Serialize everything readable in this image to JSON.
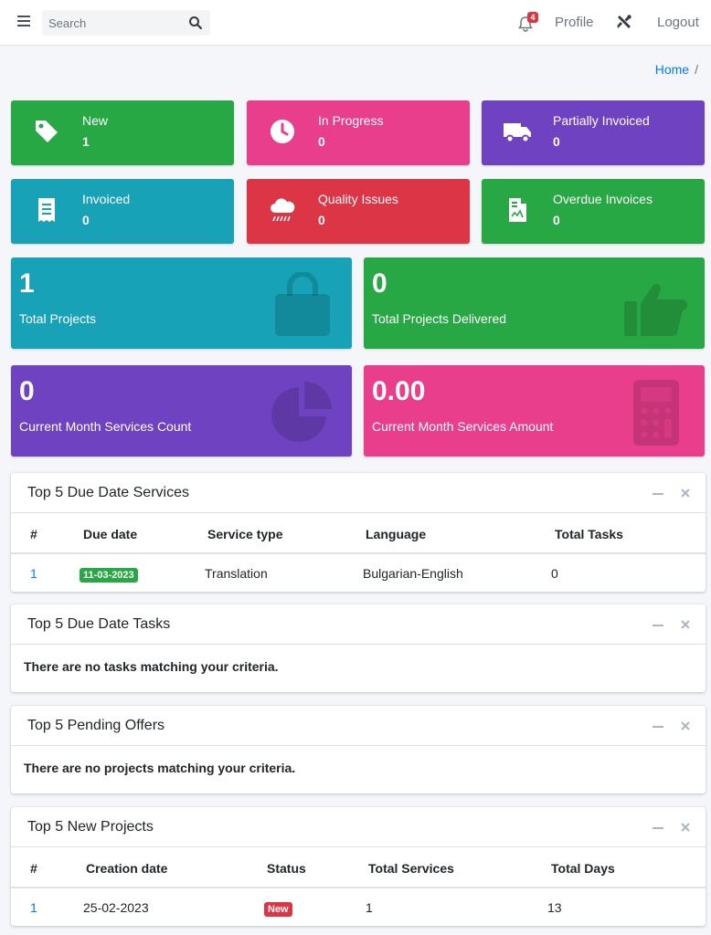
{
  "navbar": {
    "search_placeholder": "Search",
    "notifications_count": "4",
    "profile_label": "Profile",
    "logout_label": "Logout"
  },
  "breadcrumb": {
    "home": "Home",
    "separator": "/"
  },
  "status_boxes": [
    {
      "label": "New",
      "count": "1",
      "color": "#28a745",
      "icon": "tag-icon"
    },
    {
      "label": "In Progress",
      "count": "0",
      "color": "#e83e8c",
      "icon": "clock-icon"
    },
    {
      "label": "Partially Invoiced",
      "count": "0",
      "color": "#6f42c1",
      "icon": "truck-icon"
    },
    {
      "label": "Invoiced",
      "count": "0",
      "color": "#17a2b8",
      "icon": "receipt-icon"
    },
    {
      "label": "Quality Issues",
      "count": "0",
      "color": "#dc3545",
      "icon": "cloud-rain-icon"
    },
    {
      "label": "Overdue Invoices",
      "count": "0",
      "color": "#28a745",
      "icon": "file-invoice-icon"
    }
  ],
  "stat_boxes": [
    {
      "value": "1",
      "label": "Total Projects",
      "color": "#17a2b8",
      "icon": "shopping-bag-icon"
    },
    {
      "value": "0",
      "label": "Total Projects Delivered",
      "color": "#28a745",
      "icon": "thumbs-up-icon"
    },
    {
      "value": "0",
      "label": "Current Month Services Count",
      "color": "#6f42c1",
      "icon": "pie-chart-icon"
    },
    {
      "value": "0.00",
      "label": "Current Month Services Amount",
      "color": "#e83e8c",
      "icon": "calculator-icon"
    }
  ],
  "due_services": {
    "title": "Top 5 Due Date Services",
    "columns": [
      "#",
      "Due date",
      "Service type",
      "Language",
      "Total Tasks"
    ],
    "rows": [
      {
        "id": "1",
        "due_date": "11-03-2023",
        "service_type": "Translation",
        "language": "Bulgarian-English",
        "total_tasks": "0"
      }
    ]
  },
  "due_tasks": {
    "title": "Top 5 Due Date Tasks",
    "empty": "There are no tasks matching your criteria."
  },
  "pending_offers": {
    "title": "Top 5 Pending Offers",
    "empty": "There are no projects matching your criteria."
  },
  "new_projects": {
    "title": "Top 5 New Projects",
    "columns": [
      "#",
      "Creation date",
      "Status",
      "Total Services",
      "Total Days"
    ],
    "rows": [
      {
        "id": "1",
        "creation_date": "25-02-2023",
        "status": "New",
        "total_services": "1",
        "total_days": "13"
      }
    ]
  }
}
